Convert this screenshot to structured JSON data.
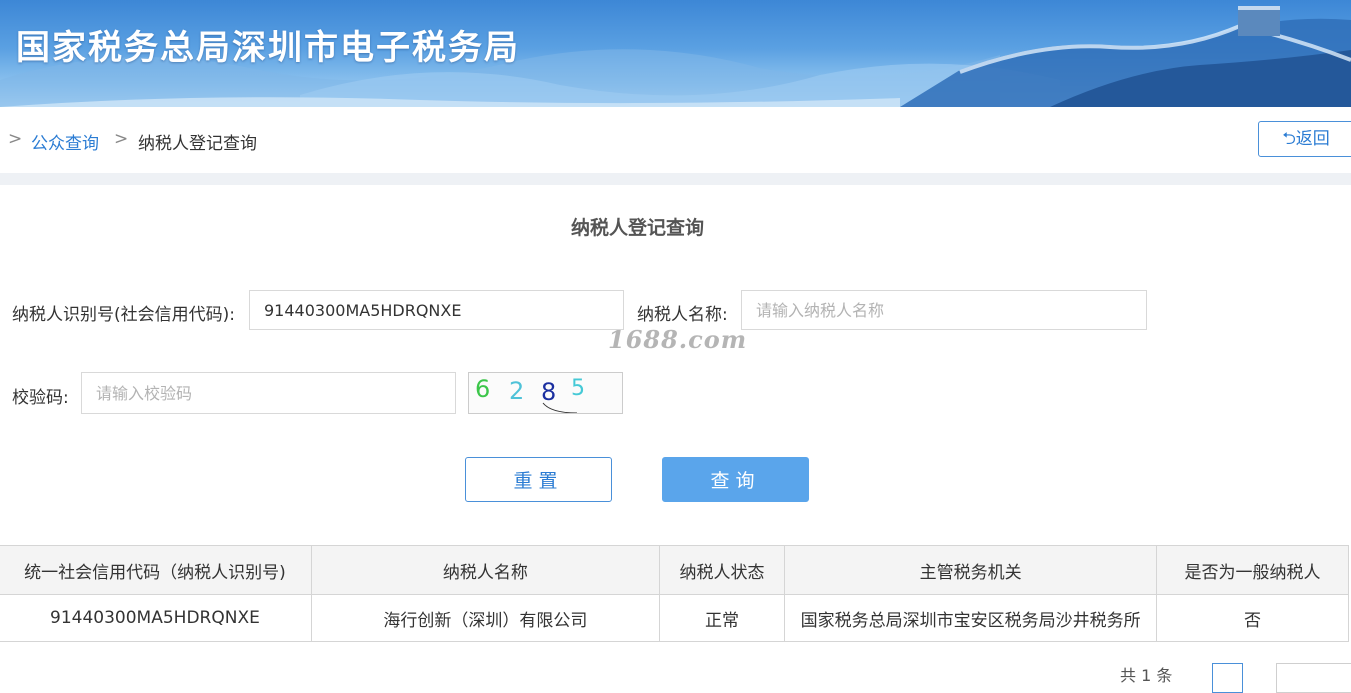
{
  "header": {
    "title": "国家税务总局深圳市电子税务局"
  },
  "breadcrumb": {
    "sep": ">",
    "link": "公众查询",
    "current": "纳税人登记查询"
  },
  "back_button": {
    "label": "⮌返回"
  },
  "form": {
    "title": "纳税人登记查询",
    "taxid_label": "纳税人识别号(社会信用代码):",
    "taxid_value": "91440300MA5HDRQNXE",
    "name_label": "纳税人名称:",
    "name_placeholder": "请输入纳税人名称",
    "code_label": "校验码:",
    "code_placeholder": "请输入校验码",
    "captcha_digits": [
      "6",
      "2",
      "8",
      "5"
    ],
    "reset_label": "重置",
    "query_label": "查询"
  },
  "watermark": "1688.com",
  "table": {
    "headers": [
      "统一社会信用代码（纳税人识别号)",
      "纳税人名称",
      "纳税人状态",
      "主管税务机关",
      "是否为一般纳税人"
    ],
    "rows": [
      [
        "91440300MA5HDRQNXE",
        "海行创新（深圳）有限公司",
        "正常",
        "国家税务总局深圳市宝安区税务局沙井税务所",
        "否"
      ]
    ]
  },
  "pager": {
    "total_text": "共 1 条"
  },
  "colors": {
    "accent": "#2b7cd3",
    "button_fill": "#5aa5eb",
    "banner": "#4a94dc"
  }
}
